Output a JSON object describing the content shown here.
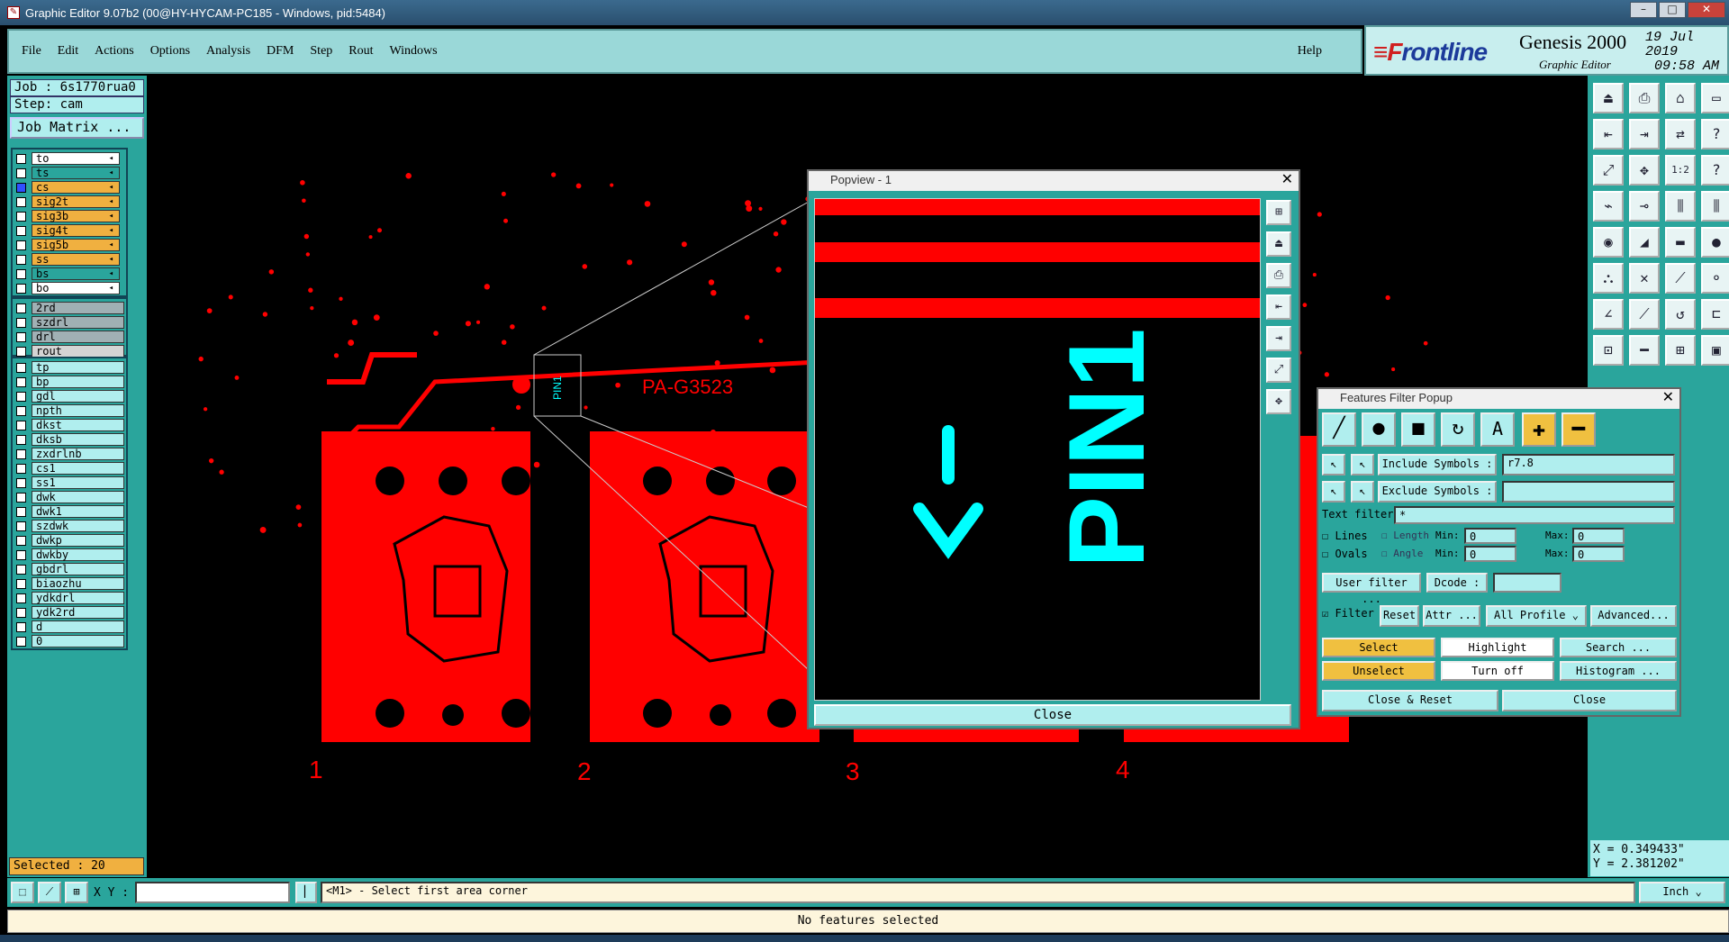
{
  "window": {
    "title": "Graphic Editor 9.07b2 (00@HY-HYCAM-PC185 - Windows, pid:5484)",
    "controls": [
      "–",
      "□",
      "✕"
    ]
  },
  "menu": {
    "items": [
      "File",
      "Edit",
      "Actions",
      "Options",
      "Analysis",
      "DFM",
      "Step",
      "Rout",
      "Windows"
    ],
    "help": "Help"
  },
  "brand": {
    "logo_red": "≡F",
    "logo_blue": "rontline",
    "product": "Genesis 2000",
    "subtitle": "Graphic Editor",
    "date": "19 Jul 2019",
    "time": "09:58 AM"
  },
  "job": {
    "job": "Job : 6s1770rua0",
    "step": "Step: cam",
    "matrix": "Job Matrix ..."
  },
  "layers": {
    "group1": [
      {
        "name": "to",
        "color": "#ffffff",
        "arrow": true
      },
      {
        "name": "ts",
        "color": "#2aa59c",
        "arrow": true
      },
      {
        "name": "cs",
        "color": "#f0b040",
        "arrow": true,
        "active": true
      },
      {
        "name": "sig2t",
        "color": "#f0b040",
        "arrow": true
      },
      {
        "name": "sig3b",
        "color": "#f0b040",
        "arrow": true
      },
      {
        "name": "sig4t",
        "color": "#f0b040",
        "arrow": true
      },
      {
        "name": "sig5b",
        "color": "#f0b040",
        "arrow": true
      },
      {
        "name": "ss",
        "color": "#f0b040",
        "arrow": true
      },
      {
        "name": "bs",
        "color": "#2aa59c",
        "arrow": true
      },
      {
        "name": "bo",
        "color": "#ffffff",
        "arrow": true
      }
    ],
    "group2": [
      {
        "name": "2rd",
        "color": "#a0b0b4"
      },
      {
        "name": "szdrl",
        "color": "#a0b0b4"
      },
      {
        "name": "drl",
        "color": "#a0b0b4"
      },
      {
        "name": "rout",
        "color": "#d4d4d4"
      }
    ],
    "group3": [
      {
        "name": "tp"
      },
      {
        "name": "bp"
      },
      {
        "name": "gdl"
      },
      {
        "name": "npth"
      },
      {
        "name": "dkst"
      },
      {
        "name": "dksb"
      },
      {
        "name": "zxdrlnb"
      },
      {
        "name": "cs1"
      },
      {
        "name": "ss1"
      },
      {
        "name": "dwk"
      },
      {
        "name": "dwk1"
      },
      {
        "name": "szdwk"
      },
      {
        "name": "dwkp"
      },
      {
        "name": "dwkby"
      },
      {
        "name": "gbdrl"
      },
      {
        "name": "biaozhu"
      },
      {
        "name": "ydkdrl"
      },
      {
        "name": "ydk2rd"
      },
      {
        "name": "d"
      },
      {
        "name": "0"
      }
    ]
  },
  "selected": "Selected : 20",
  "pcb": {
    "label": "PA-G3523",
    "pin_label": "PIN1",
    "numbers": [
      "1",
      "2",
      "3",
      "4"
    ],
    "color": "#ff0000"
  },
  "popview": {
    "title": "Popview - 1",
    "close_label": "Close",
    "pin_text": "PIN1"
  },
  "filter": {
    "title": "Features Filter Popup",
    "include_label": "Include Symbols :",
    "include_value": "r7.8",
    "exclude_label": "Exclude Symbols :",
    "exclude_value": "",
    "text_filter_label": "Text filter",
    "text_filter_value": "*",
    "lines_label": "Lines",
    "ovals_label": "Ovals",
    "length_label": "Length",
    "angle_label": "Angle",
    "min_label": "Min:",
    "max_label": "Max:",
    "min_length": "0",
    "max_length": "0",
    "min_angle": "0",
    "max_angle": "0",
    "user_filter": "User filter ...",
    "dcode_label": "Dcode :",
    "dcode_value": "",
    "filter_label": "Filter",
    "reset": "Reset",
    "attr": "Attr ...",
    "profile": "All Profile",
    "advanced": "Advanced...",
    "select": "Select",
    "highlight": "Highlight",
    "search": "Search ...",
    "unselect": "Unselect",
    "turnoff": "Turn off",
    "histogram": "Histogram ...",
    "close_reset": "Close & Reset",
    "close": "Close"
  },
  "coords": {
    "x": "X = 0.349433\"",
    "y": "Y = 2.381202\""
  },
  "bottom": {
    "xy_label": "X Y :",
    "hint": "<M1> - Select first area corner",
    "units": "Inch",
    "status": "No features selected"
  }
}
